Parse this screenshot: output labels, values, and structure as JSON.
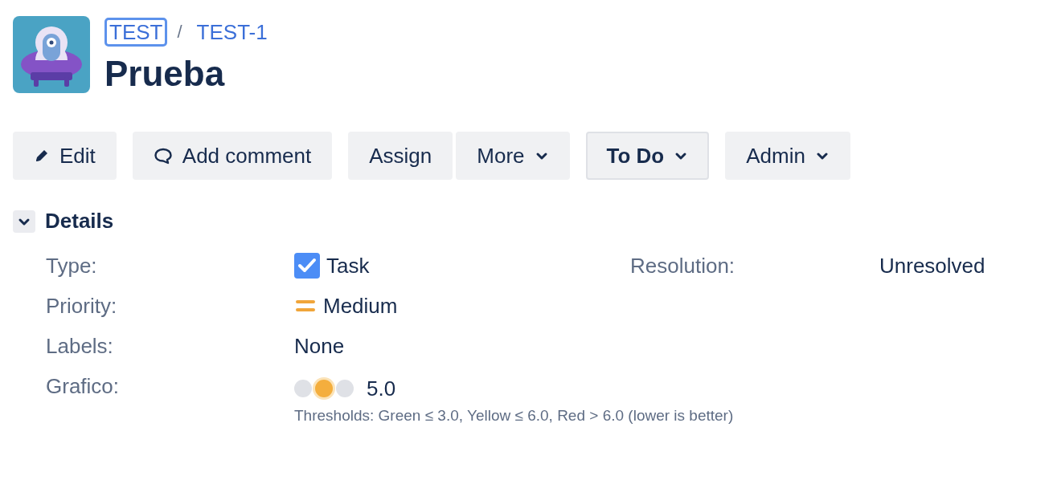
{
  "header": {
    "breadcrumbs": [
      {
        "label": "TEST",
        "focused": true
      },
      {
        "label": "TEST-1",
        "focused": false
      }
    ],
    "separator": "/",
    "title": "Prueba"
  },
  "toolbar": [
    {
      "buttons": [
        {
          "label": "Edit",
          "kind": "edit"
        }
      ]
    },
    {
      "buttons": [
        {
          "label": "Add comment",
          "kind": "comment"
        }
      ]
    },
    {
      "buttons": [
        {
          "label": "Assign",
          "kind": "action"
        },
        {
          "label": "More",
          "kind": "menu"
        }
      ]
    },
    {
      "buttons": [
        {
          "label": "To Do",
          "kind": "status"
        }
      ]
    },
    {
      "buttons": [
        {
          "label": "Admin",
          "kind": "menu"
        }
      ]
    }
  ],
  "details": {
    "title": "Details",
    "expanded": true,
    "left": [
      {
        "label": "Type:",
        "value": "Task",
        "kind": "task"
      },
      {
        "label": "Priority:",
        "value": "Medium",
        "kind": "priority"
      },
      {
        "label": "Labels:",
        "value": "None",
        "kind": "text"
      },
      {
        "label": "Grafico:",
        "value": "5.0",
        "kind": "lights",
        "lights": [
          {
            "lit": false,
            "color": "#dfe1e6"
          },
          {
            "lit": true,
            "color": "#f4ae3d"
          },
          {
            "lit": false,
            "color": "#dfe1e6"
          }
        ],
        "note": "Thresholds: Green ≤ 3.0, Yellow ≤ 6.0, Red > 6.0 (lower is better)"
      }
    ],
    "right": [
      {
        "label": "Resolution:",
        "value": "Unresolved"
      }
    ]
  }
}
